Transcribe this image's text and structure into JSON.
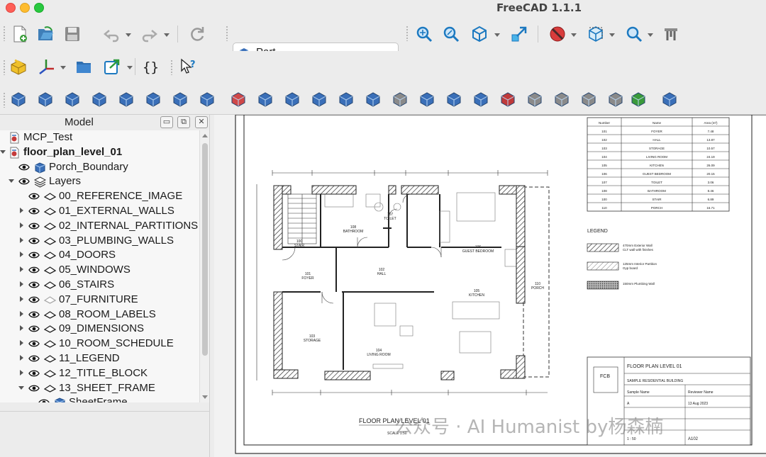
{
  "window": {
    "title": "FreeCAD 1.1.1"
  },
  "workbench": {
    "selected": "Part"
  },
  "toolbar_icons": {
    "row1": [
      "new-document-icon",
      "open-icon",
      "save-icon",
      "undo-icon",
      "redo-icon",
      "refresh-icon",
      "fit-all-icon",
      "zoom-selection-icon",
      "isometric-view-icon",
      "view-arrow-icon",
      "draw-style-icon",
      "bounding-box-icon",
      "zoom-icon",
      "measure-icon"
    ],
    "row2": [
      "part-icon",
      "axis-icon",
      "folder-icon",
      "link-icon",
      "macro-braces-icon",
      "whats-this-icon"
    ],
    "row3": [
      "cube-icon",
      "cylinder-icon",
      "sphere-icon",
      "cone-icon",
      "torus-icon",
      "tube-icon",
      "primitives-icon",
      "shape-builder-icon",
      "boolean-icon",
      "extrude-icon",
      "revolve-icon",
      "mirror-icon",
      "fillet-icon",
      "chamfer-icon",
      "make-face-icon",
      "ruled-surface-icon",
      "loft-icon",
      "sweep-icon",
      "section-icon",
      "cross-sections-icon",
      "offset-icon",
      "thickness-icon",
      "projection-icon",
      "color-per-face-icon",
      "attachment-icon"
    ]
  },
  "model_panel": {
    "title": "Model",
    "tree": [
      {
        "label": "MCP_Test",
        "level": 0,
        "expander": "none",
        "eye": false,
        "icon": "document",
        "bold": false
      },
      {
        "label": "floor_plan_level_01",
        "level": 0,
        "expander": "down",
        "eye": false,
        "icon": "document",
        "bold": true
      },
      {
        "label": "Porch_Boundary",
        "level": 1,
        "expander": "none",
        "eye": true,
        "icon": "part",
        "bold": false
      },
      {
        "label": "Layers",
        "level": 1,
        "expander": "down",
        "eye": true,
        "icon": "layers",
        "bold": false
      },
      {
        "label": "00_REFERENCE_IMAGE",
        "level": 2,
        "expander": "none",
        "eye": true,
        "icon": "layer",
        "bold": false
      },
      {
        "label": "01_EXTERNAL_WALLS",
        "level": 2,
        "expander": "right",
        "eye": true,
        "icon": "layer",
        "bold": false
      },
      {
        "label": "02_INTERNAL_PARTITIONS",
        "level": 2,
        "expander": "right",
        "eye": true,
        "icon": "layer",
        "bold": false
      },
      {
        "label": "03_PLUMBING_WALLS",
        "level": 2,
        "expander": "right",
        "eye": true,
        "icon": "layer",
        "bold": false
      },
      {
        "label": "04_DOORS",
        "level": 2,
        "expander": "right",
        "eye": true,
        "icon": "layer",
        "bold": false
      },
      {
        "label": "05_WINDOWS",
        "level": 2,
        "expander": "right",
        "eye": true,
        "icon": "layer",
        "bold": false
      },
      {
        "label": "06_STAIRS",
        "level": 2,
        "expander": "right",
        "eye": true,
        "icon": "layer",
        "bold": false
      },
      {
        "label": "07_FURNITURE",
        "level": 2,
        "expander": "right",
        "eye": true,
        "icon": "layer-faded",
        "bold": false
      },
      {
        "label": "08_ROOM_LABELS",
        "level": 2,
        "expander": "right",
        "eye": true,
        "icon": "layer",
        "bold": false
      },
      {
        "label": "09_DIMENSIONS",
        "level": 2,
        "expander": "right",
        "eye": true,
        "icon": "layer",
        "bold": false
      },
      {
        "label": "10_ROOM_SCHEDULE",
        "level": 2,
        "expander": "right",
        "eye": true,
        "icon": "layer",
        "bold": false
      },
      {
        "label": "11_LEGEND",
        "level": 2,
        "expander": "right",
        "eye": true,
        "icon": "layer",
        "bold": false
      },
      {
        "label": "12_TITLE_BLOCK",
        "level": 2,
        "expander": "right",
        "eye": true,
        "icon": "layer",
        "bold": false
      },
      {
        "label": "13_SHEET_FRAME",
        "level": 2,
        "expander": "down",
        "eye": true,
        "icon": "layer",
        "bold": false
      },
      {
        "label": "SheetFrame",
        "level": 3,
        "expander": "none",
        "eye": true,
        "icon": "part",
        "bold": false
      }
    ]
  },
  "drawing": {
    "rooms": [
      {
        "label": "108\nBATHROOM"
      },
      {
        "label": "107\nTOILET"
      },
      {
        "label": "106\nGUEST BEDROOM"
      },
      {
        "label": "100\nSTAIR"
      },
      {
        "label": "101\nFOYER"
      },
      {
        "label": "102\nHALL"
      },
      {
        "label": "105\nKITCHEN"
      },
      {
        "label": "110\nPORCH"
      },
      {
        "label": "103\nSTORAGE"
      },
      {
        "label": "104\nLIVING ROOM"
      }
    ],
    "plan_title": "FLOOR PLAN LEVEL 01",
    "plan_scale": "SCALE 1:50",
    "schedule": {
      "headers": [
        "Number",
        "Name",
        "Area (m²)"
      ],
      "rows": [
        [
          "101",
          "FOYER",
          "7.48"
        ],
        [
          "102",
          "HALL",
          "13.87"
        ],
        [
          "103",
          "STORAGE",
          "10.57"
        ],
        [
          "104",
          "LIVING ROOM",
          "24.19"
        ],
        [
          "105",
          "KITCHEN",
          "26.09"
        ],
        [
          "106",
          "GUEST BEDROOM",
          "20.15"
        ],
        [
          "107",
          "TOILET",
          "3.06"
        ],
        [
          "108",
          "BATHROOM",
          "8.46"
        ],
        [
          "100",
          "STAIR",
          "6.89"
        ],
        [
          "110",
          "PORCH",
          "16.71"
        ]
      ]
    },
    "legend": {
      "title": "LEGEND",
      "items": [
        "470mm Exterior Wall",
        "125mm Interior Partition",
        "150mm Plumbing Wall"
      ],
      "subitems": [
        "CLT wall with finishes",
        "Gyp board",
        ""
      ]
    },
    "title_block": {
      "logo": "FCB",
      "drawing_title": "FLOOR PLAN LEVEL 01",
      "project": "SAMPLE RESIDENTIAL BUILDING",
      "drawn_by": "Sample Name",
      "checked_by": "Reviewer Name",
      "revision": "A",
      "date": "13 Aug 2023",
      "scale": "1 : 50",
      "sheet": "A102"
    }
  },
  "watermark": "公众号 · AI Humanist by杨森楠"
}
